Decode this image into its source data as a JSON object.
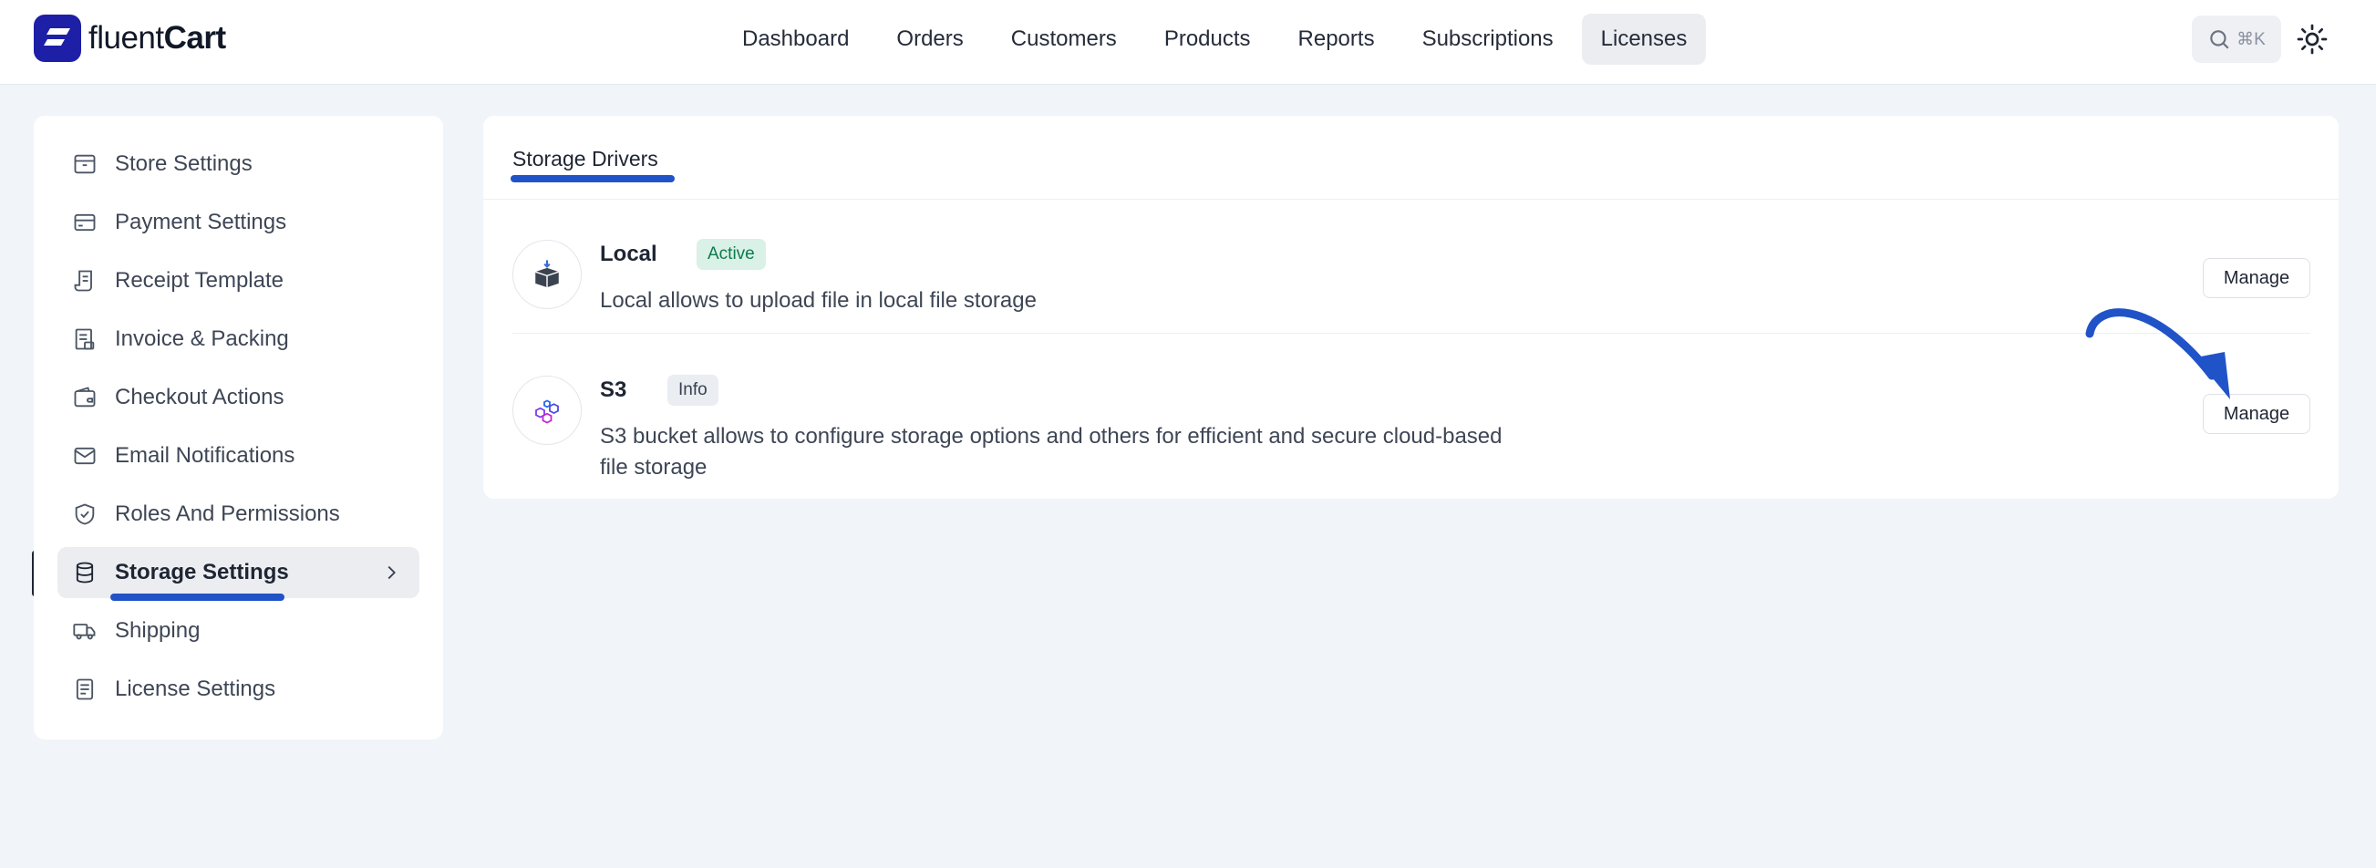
{
  "brand": {
    "name_light": "fluent",
    "name_bold": "Cart"
  },
  "nav": {
    "items": [
      {
        "label": "Dashboard"
      },
      {
        "label": "Orders"
      },
      {
        "label": "Customers"
      },
      {
        "label": "Products"
      },
      {
        "label": "Reports"
      },
      {
        "label": "Subscriptions"
      },
      {
        "label": "Licenses"
      }
    ],
    "active": "Licenses",
    "search_shortcut": "⌘K"
  },
  "sidebar": {
    "items": [
      {
        "label": "Store Settings",
        "icon": "store-icon"
      },
      {
        "label": "Payment Settings",
        "icon": "credit-card-icon"
      },
      {
        "label": "Receipt Template",
        "icon": "receipt-icon"
      },
      {
        "label": "Invoice & Packing",
        "icon": "invoice-icon"
      },
      {
        "label": "Checkout Actions",
        "icon": "wallet-icon"
      },
      {
        "label": "Email Notifications",
        "icon": "mail-icon"
      },
      {
        "label": "Roles And Permissions",
        "icon": "shield-check-icon"
      },
      {
        "label": "Storage Settings",
        "icon": "database-icon"
      },
      {
        "label": "Shipping",
        "icon": "truck-icon"
      },
      {
        "label": "License Settings",
        "icon": "document-icon"
      }
    ],
    "active": "Storage Settings"
  },
  "main": {
    "tab": "Storage Drivers",
    "drivers": [
      {
        "name": "Local",
        "badge": "Active",
        "description": "Local allows to upload file in local file storage",
        "button": "Manage",
        "icon": "box-icon"
      },
      {
        "name": "S3",
        "badge": "Info",
        "description": "S3 bucket allows to configure storage options and others for efficient and secure cloud-based file storage",
        "button": "Manage",
        "icon": "s3-cubes-icon"
      }
    ]
  },
  "colors": {
    "accent": "#2153c8",
    "brand": "#1d1fa6",
    "active_badge_bg": "#d9f1e6",
    "active_badge_text": "#0e7a4f",
    "page_bg": "#f1f4f9"
  }
}
